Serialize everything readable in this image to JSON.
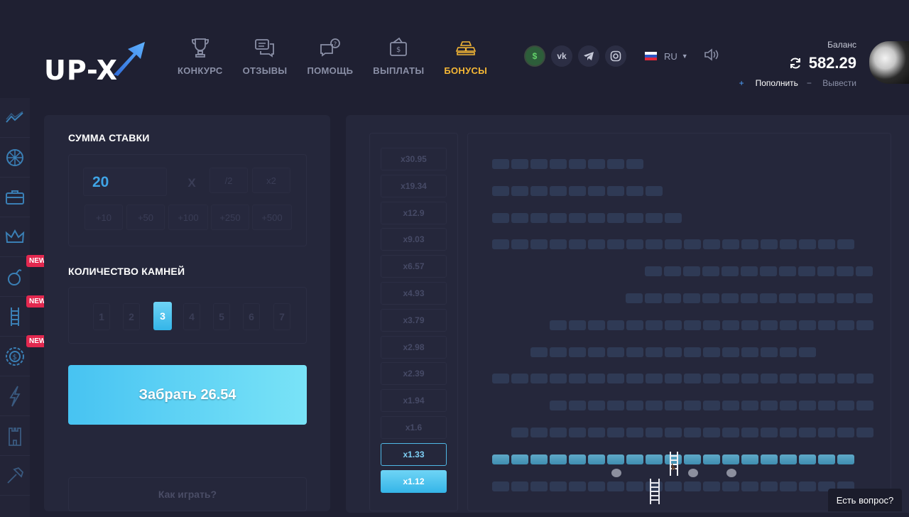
{
  "brand": {
    "logo": "UP-X"
  },
  "nav": [
    {
      "label": "КОНКУРС",
      "icon": "trophy-icon",
      "active": false
    },
    {
      "label": "ОТЗЫВЫ",
      "icon": "chat-icon",
      "active": false
    },
    {
      "label": "ПОМОЩЬ",
      "icon": "help-icon",
      "active": false
    },
    {
      "label": "ВЫПЛАТЫ",
      "icon": "wallet-icon",
      "active": false
    },
    {
      "label": "БОНУСЫ",
      "icon": "gold-icon",
      "active": true
    }
  ],
  "socials": [
    "dollar-icon",
    "vk-icon",
    "telegram-icon",
    "instagram-icon"
  ],
  "lang": "RU",
  "balance": {
    "label": "Баланс",
    "value": "582.29",
    "deposit": "Пополнить",
    "withdraw": "Вывести"
  },
  "sidebar": {
    "items": [
      "trend-icon",
      "wheel-icon",
      "case-icon",
      "crown-icon",
      "bomb-icon",
      "ladder-icon",
      "coin-icon",
      "lightning-icon",
      "tower-icon",
      "hammer-icon"
    ],
    "new_badge": "NEW"
  },
  "bet": {
    "title": "СУММА СТАВКИ",
    "amount": "20",
    "clear": "X",
    "half": "/2",
    "double": "x2",
    "quick": [
      "+10",
      "+50",
      "+100",
      "+250",
      "+500"
    ]
  },
  "stones": {
    "title": "КОЛИЧЕСТВО КАМНЕЙ",
    "options": [
      "1",
      "2",
      "3",
      "4",
      "5",
      "6",
      "7"
    ],
    "selected": "3"
  },
  "take_button": "Забрать 26.54",
  "how_to_play": "Как играть?",
  "multipliers": [
    "x30.95",
    "x19.34",
    "x12.9",
    "x9.03",
    "x6.57",
    "x4.93",
    "x3.79",
    "x2.98",
    "x2.39",
    "x1.94",
    "x1.6",
    "x1.33",
    "x1.12"
  ],
  "current_multiplier": "x1.33",
  "passed_multiplier": "x1.12",
  "help_chat": "Есть вопрос?"
}
